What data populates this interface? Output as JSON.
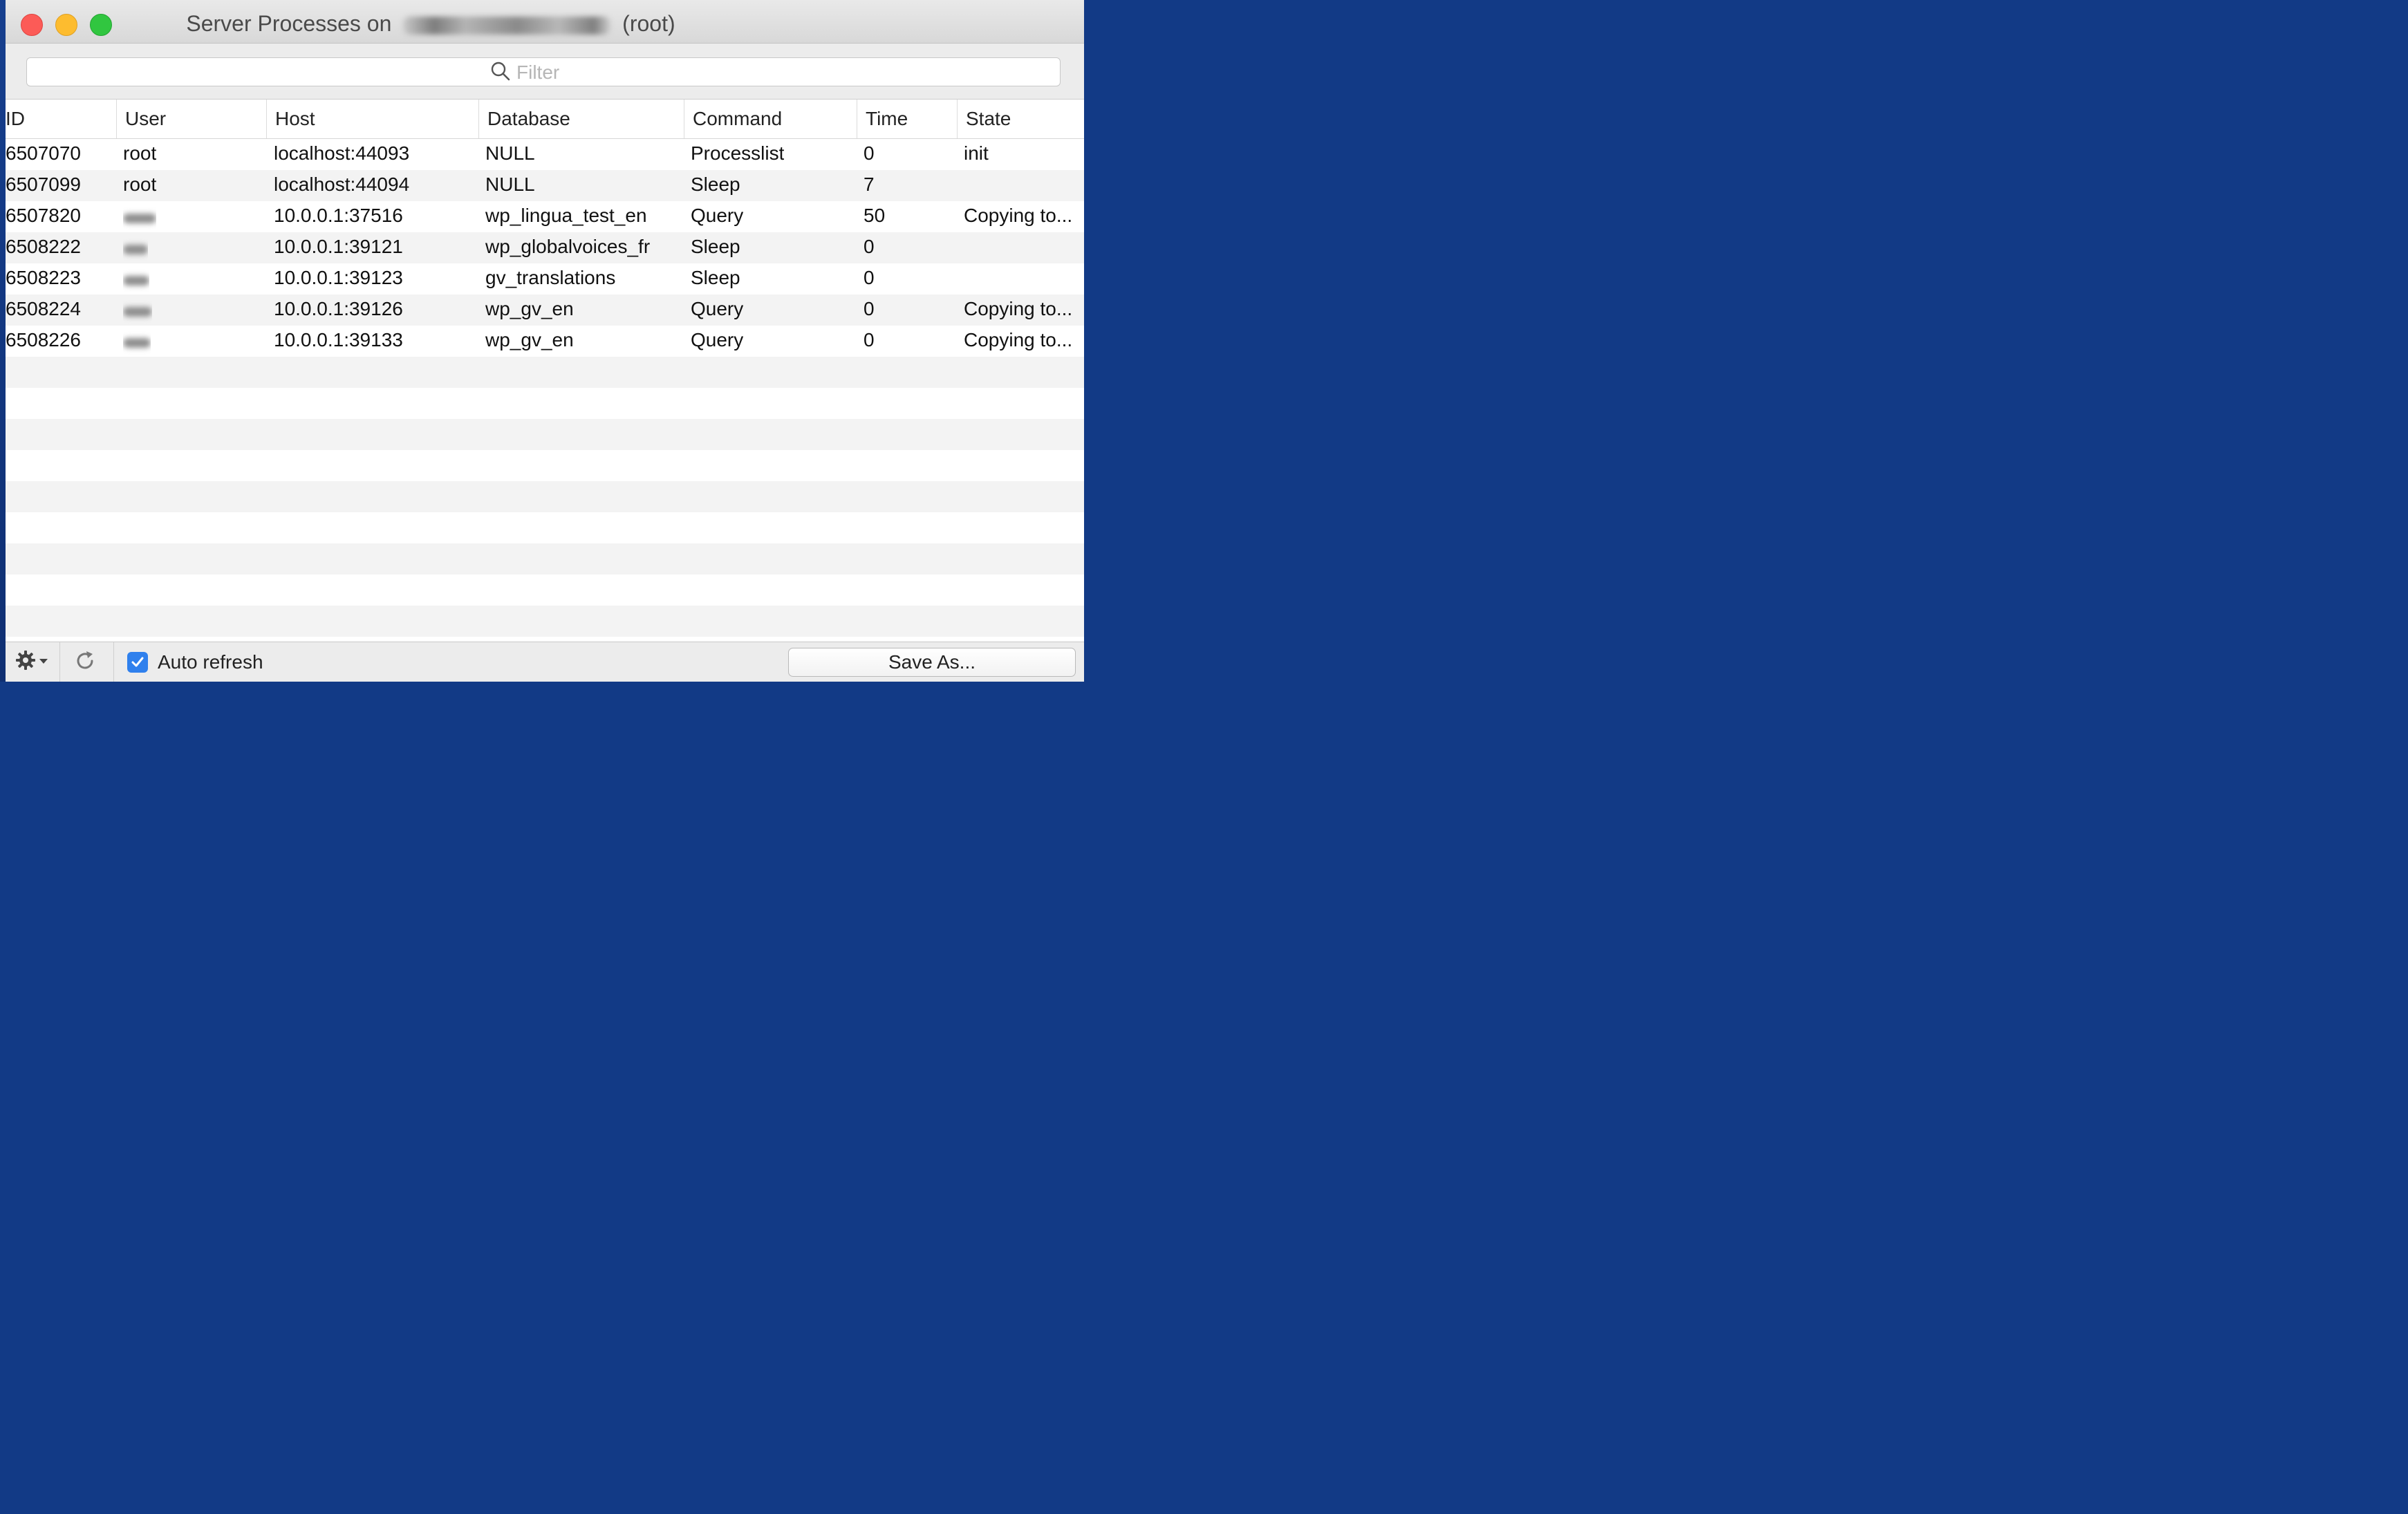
{
  "window": {
    "title_prefix": "Server Processes on",
    "title_suffix": "(root)"
  },
  "filter": {
    "placeholder": "Filter"
  },
  "columns": [
    "ID",
    "User",
    "Host",
    "Database",
    "Command",
    "Time",
    "State"
  ],
  "rows": [
    {
      "id": "6507070",
      "user": "root",
      "host": "localhost:44093",
      "database": "NULL",
      "command": "Processlist",
      "time": "0",
      "state": "init"
    },
    {
      "id": "6507099",
      "user": "root",
      "host": "localhost:44094",
      "database": "NULL",
      "command": "Sleep",
      "time": "7",
      "state": ""
    },
    {
      "id": "6507820",
      "user": "",
      "host": "10.0.0.1:37516",
      "database": "wp_lingua_test_en",
      "command": "Query",
      "time": "50",
      "state": "Copying to..."
    },
    {
      "id": "6508222",
      "user": "",
      "host": "10.0.0.1:39121",
      "database": "wp_globalvoices_fr",
      "command": "Sleep",
      "time": "0",
      "state": ""
    },
    {
      "id": "6508223",
      "user": "",
      "host": "10.0.0.1:39123",
      "database": "gv_translations",
      "command": "Sleep",
      "time": "0",
      "state": ""
    },
    {
      "id": "6508224",
      "user": "",
      "host": "10.0.0.1:39126",
      "database": "wp_gv_en",
      "command": "Query",
      "time": "0",
      "state": "Copying to..."
    },
    {
      "id": "6508226",
      "user": "",
      "host": "10.0.0.1:39133",
      "database": "wp_gv_en",
      "command": "Query",
      "time": "0",
      "state": "Copying to..."
    }
  ],
  "footer": {
    "auto_refresh_label": "Auto refresh",
    "auto_refresh_checked": true,
    "save_label": "Save As..."
  },
  "colors": {
    "accent": "#2f80ed",
    "close": "#fc5b57",
    "minimize": "#fdbc2f",
    "maximize": "#31c640"
  },
  "icons": [
    "search-icon",
    "gear-icon",
    "chevron-down-icon",
    "refresh-icon",
    "checkmark-icon"
  ]
}
